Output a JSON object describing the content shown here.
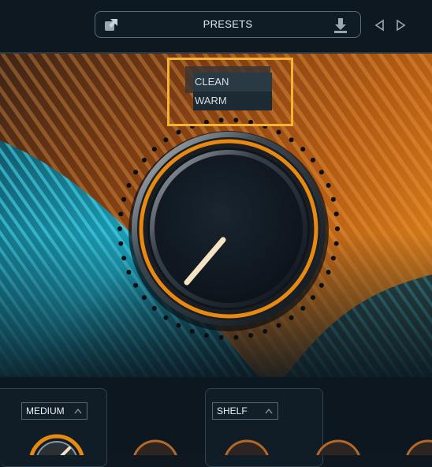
{
  "header": {
    "presets_label": "PRESETS",
    "icons": [
      "open-external-icon",
      "download-icon",
      "previous-triangle-icon",
      "next-triangle-icon"
    ]
  },
  "dropdown": {
    "items": [
      {
        "label": "CLEAN"
      },
      {
        "label": "WARM"
      }
    ],
    "highlight_color": "#f6b233"
  },
  "main_knob": {
    "accent_color": "#e88a12"
  },
  "bottom": {
    "left_select": {
      "value": "MEDIUM"
    },
    "right_select": {
      "value": "SHELF"
    }
  },
  "colors": {
    "background": "#0f1820",
    "orange": "#e88a12",
    "cyan": "#21b8d4"
  }
}
